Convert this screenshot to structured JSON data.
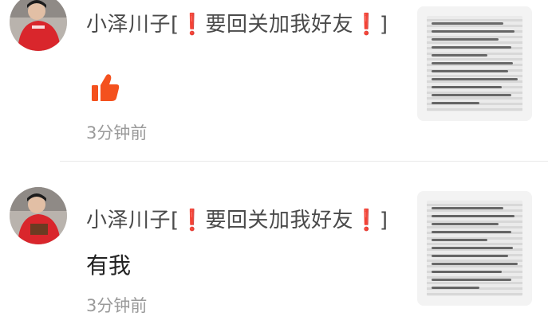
{
  "comments": [
    {
      "username_prefix": "小泽川子[",
      "bang_left": "❗",
      "username_middle": "要回关加我好友",
      "bang_right": "❗",
      "username_suffix": "]",
      "content": "",
      "content_icon": "thumbs-up-icon",
      "time": "3分钟前",
      "thumbnail_icon": "handwritten-note-image"
    },
    {
      "username_prefix": "小泽川子[",
      "bang_left": "❗",
      "username_middle": "要回关加我好友",
      "bang_right": "❗",
      "username_suffix": "]",
      "content": "有我",
      "time": "3分钟前",
      "thumbnail_icon": "handwritten-note-image"
    }
  ],
  "colors": {
    "accent_red": "#e8243a",
    "like_orange": "#f4511e",
    "time_gray": "#9a9a9a",
    "name_gray": "#4a4a4a"
  }
}
